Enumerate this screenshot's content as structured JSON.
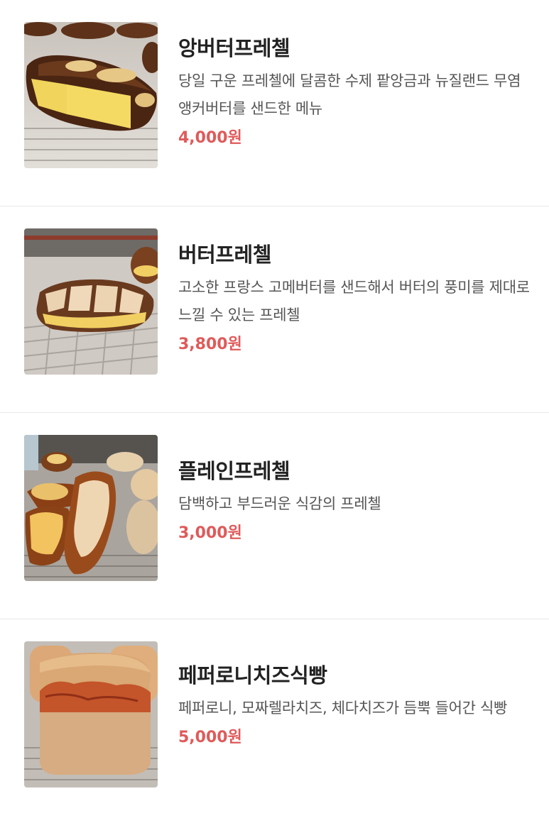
{
  "menu": {
    "items": [
      {
        "name": "앙버터프레첼",
        "description": "당일 구운 프레첼에 달콤한 수제 팥앙금과 뉴질랜드 무염 앵커버터를 샌드한 메뉴",
        "price": "4,000원",
        "image": "pretzel-with-red-bean-and-butter-photo"
      },
      {
        "name": "버터프레첼",
        "description": "고소한 프랑스 고메버터를 샌드해서 버터의 풍미를 제대로 느낄 수 있는 프레첼",
        "price": "3,800원",
        "image": "butter-pretzel-photo"
      },
      {
        "name": "플레인프레첼",
        "description": "담백하고 부드러운 식감의 프레첼",
        "price": "3,000원",
        "image": "plain-pretzel-photo"
      },
      {
        "name": "페퍼로니치즈식빵",
        "description": "페퍼로니, 모짜렐라치즈, 체다치즈가 듬뿍 들어간 식빵",
        "price": "5,000원",
        "image": "pepperoni-cheese-bread-photo"
      }
    ]
  },
  "colors": {
    "price": "#e05a5a",
    "title": "#222222",
    "description": "#555555",
    "divider": "#e9e9e9"
  }
}
